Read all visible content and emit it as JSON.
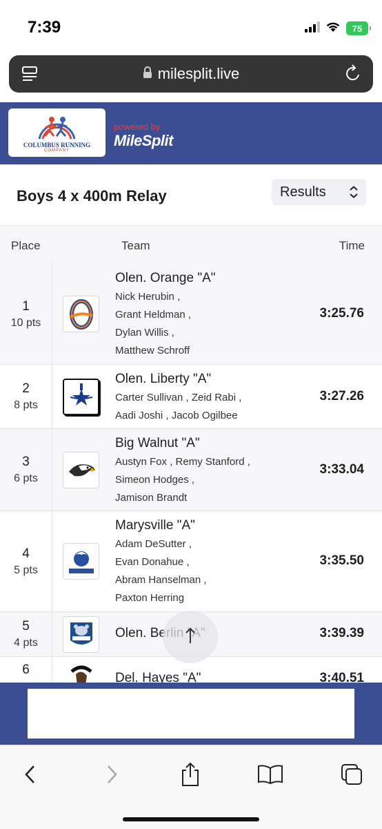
{
  "status": {
    "time": "7:39",
    "battery": "75"
  },
  "browser": {
    "url": "milesplit.live"
  },
  "banner": {
    "logo_line1": "COLUMBUS RUNNING",
    "logo_line2": "COMPANY",
    "powered_by": "powered by",
    "brand": "MileSplit"
  },
  "event": {
    "title": "Boys 4 x 400m Relay",
    "view_select": "Results"
  },
  "table": {
    "headers": {
      "place": "Place",
      "team": "Team",
      "time": "Time"
    },
    "rows": [
      {
        "place": "1",
        "points": "10 pts",
        "team": "Olen. Orange \"A\"",
        "athletes": [
          "Nick Herubin ,",
          "Grant Heldman ,",
          "Dylan Willis ,",
          "Matthew Schroff"
        ],
        "time": "3:25.76",
        "logo": "orange-o-logo"
      },
      {
        "place": "2",
        "points": "8 pts",
        "team": "Olen. Liberty \"A\"",
        "athletes": [
          "Carter Sullivan ,  Zeid Rabi ,",
          "Aadi Joshi ,  Jacob Ogilbee"
        ],
        "time": "3:27.26",
        "logo": "liberty-star-logo"
      },
      {
        "place": "3",
        "points": "6 pts",
        "team": "Big Walnut \"A\"",
        "athletes": [
          "Austyn Fox ,  Remy Stanford ,",
          "Simeon Hodges ,",
          "Jamison Brandt"
        ],
        "time": "3:33.04",
        "logo": "eagle-logo"
      },
      {
        "place": "4",
        "points": "5 pts",
        "team": "Marysville \"A\"",
        "athletes": [
          "Adam DeSutter ,",
          "Evan Donahue ,",
          "Abram Hanselman ,",
          "Paxton Herring"
        ],
        "time": "3:35.50",
        "logo": "monarchs-logo"
      },
      {
        "place": "5",
        "points": "4 pts",
        "team": "Olen. Berlin \"A\"",
        "athletes": [],
        "time": "3:39.39",
        "logo": "berlin-bear-logo"
      },
      {
        "place": "6",
        "points": "",
        "team": "Del. Hayes \"A\"",
        "athletes": [],
        "time": "3:40.51",
        "logo": "hayes-horse-logo"
      }
    ]
  },
  "colors": {
    "brand_blue": "#3b4d93",
    "powered_red": "#e8403a",
    "battery_green": "#34c759"
  }
}
